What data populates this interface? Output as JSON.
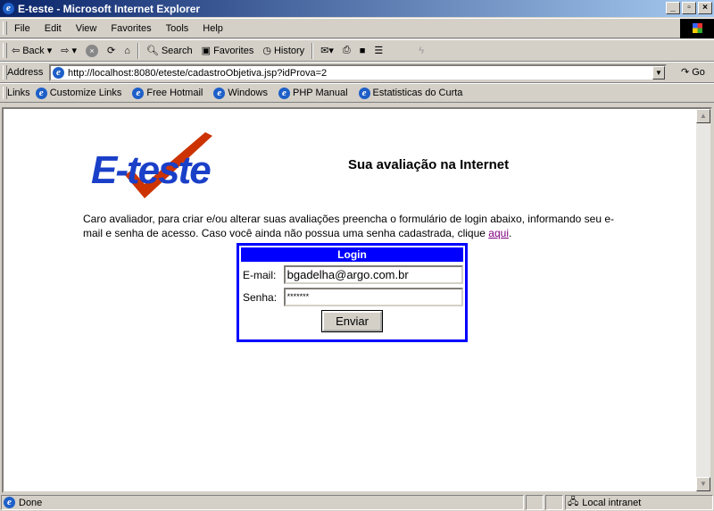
{
  "window": {
    "title": "E-teste - Microsoft Internet Explorer"
  },
  "menu": [
    "File",
    "Edit",
    "View",
    "Favorites",
    "Tools",
    "Help"
  ],
  "toolbar": {
    "back": "Back",
    "search": "Search",
    "favorites": "Favorites",
    "history": "History"
  },
  "address": {
    "label": "Address",
    "url": "http://localhost:8080/eteste/cadastroObjetiva.jsp?idProva=2",
    "go": "Go"
  },
  "links": {
    "label": "Links",
    "items": [
      "Customize Links",
      "Free Hotmail",
      "Windows",
      "PHP Manual",
      "Estatisticas do Curta"
    ]
  },
  "page": {
    "logo_text": "E-teste",
    "heading": "Sua avaliação na Internet",
    "intro": "Caro avaliador, para criar e/ou alterar suas avaliações preencha o formulário de login abaixo, informando seu e-mail e senha de acesso. Caso você ainda não possua uma senha cadastrada, clique ",
    "link": "aqui",
    "after_link": ".",
    "login": {
      "title": "Login",
      "email_label": "E-mail:",
      "email_value": "bgadelha@argo.com.br",
      "password_label": "Senha:",
      "password_value": "*******",
      "submit": "Enviar"
    }
  },
  "status": {
    "text": "Done",
    "zone": "Local intranet"
  },
  "colors": {
    "login_border": "#0000ff",
    "link_visited": "#800080",
    "logo_blue": "#1a3fc8",
    "logo_check": "#cc3300"
  }
}
